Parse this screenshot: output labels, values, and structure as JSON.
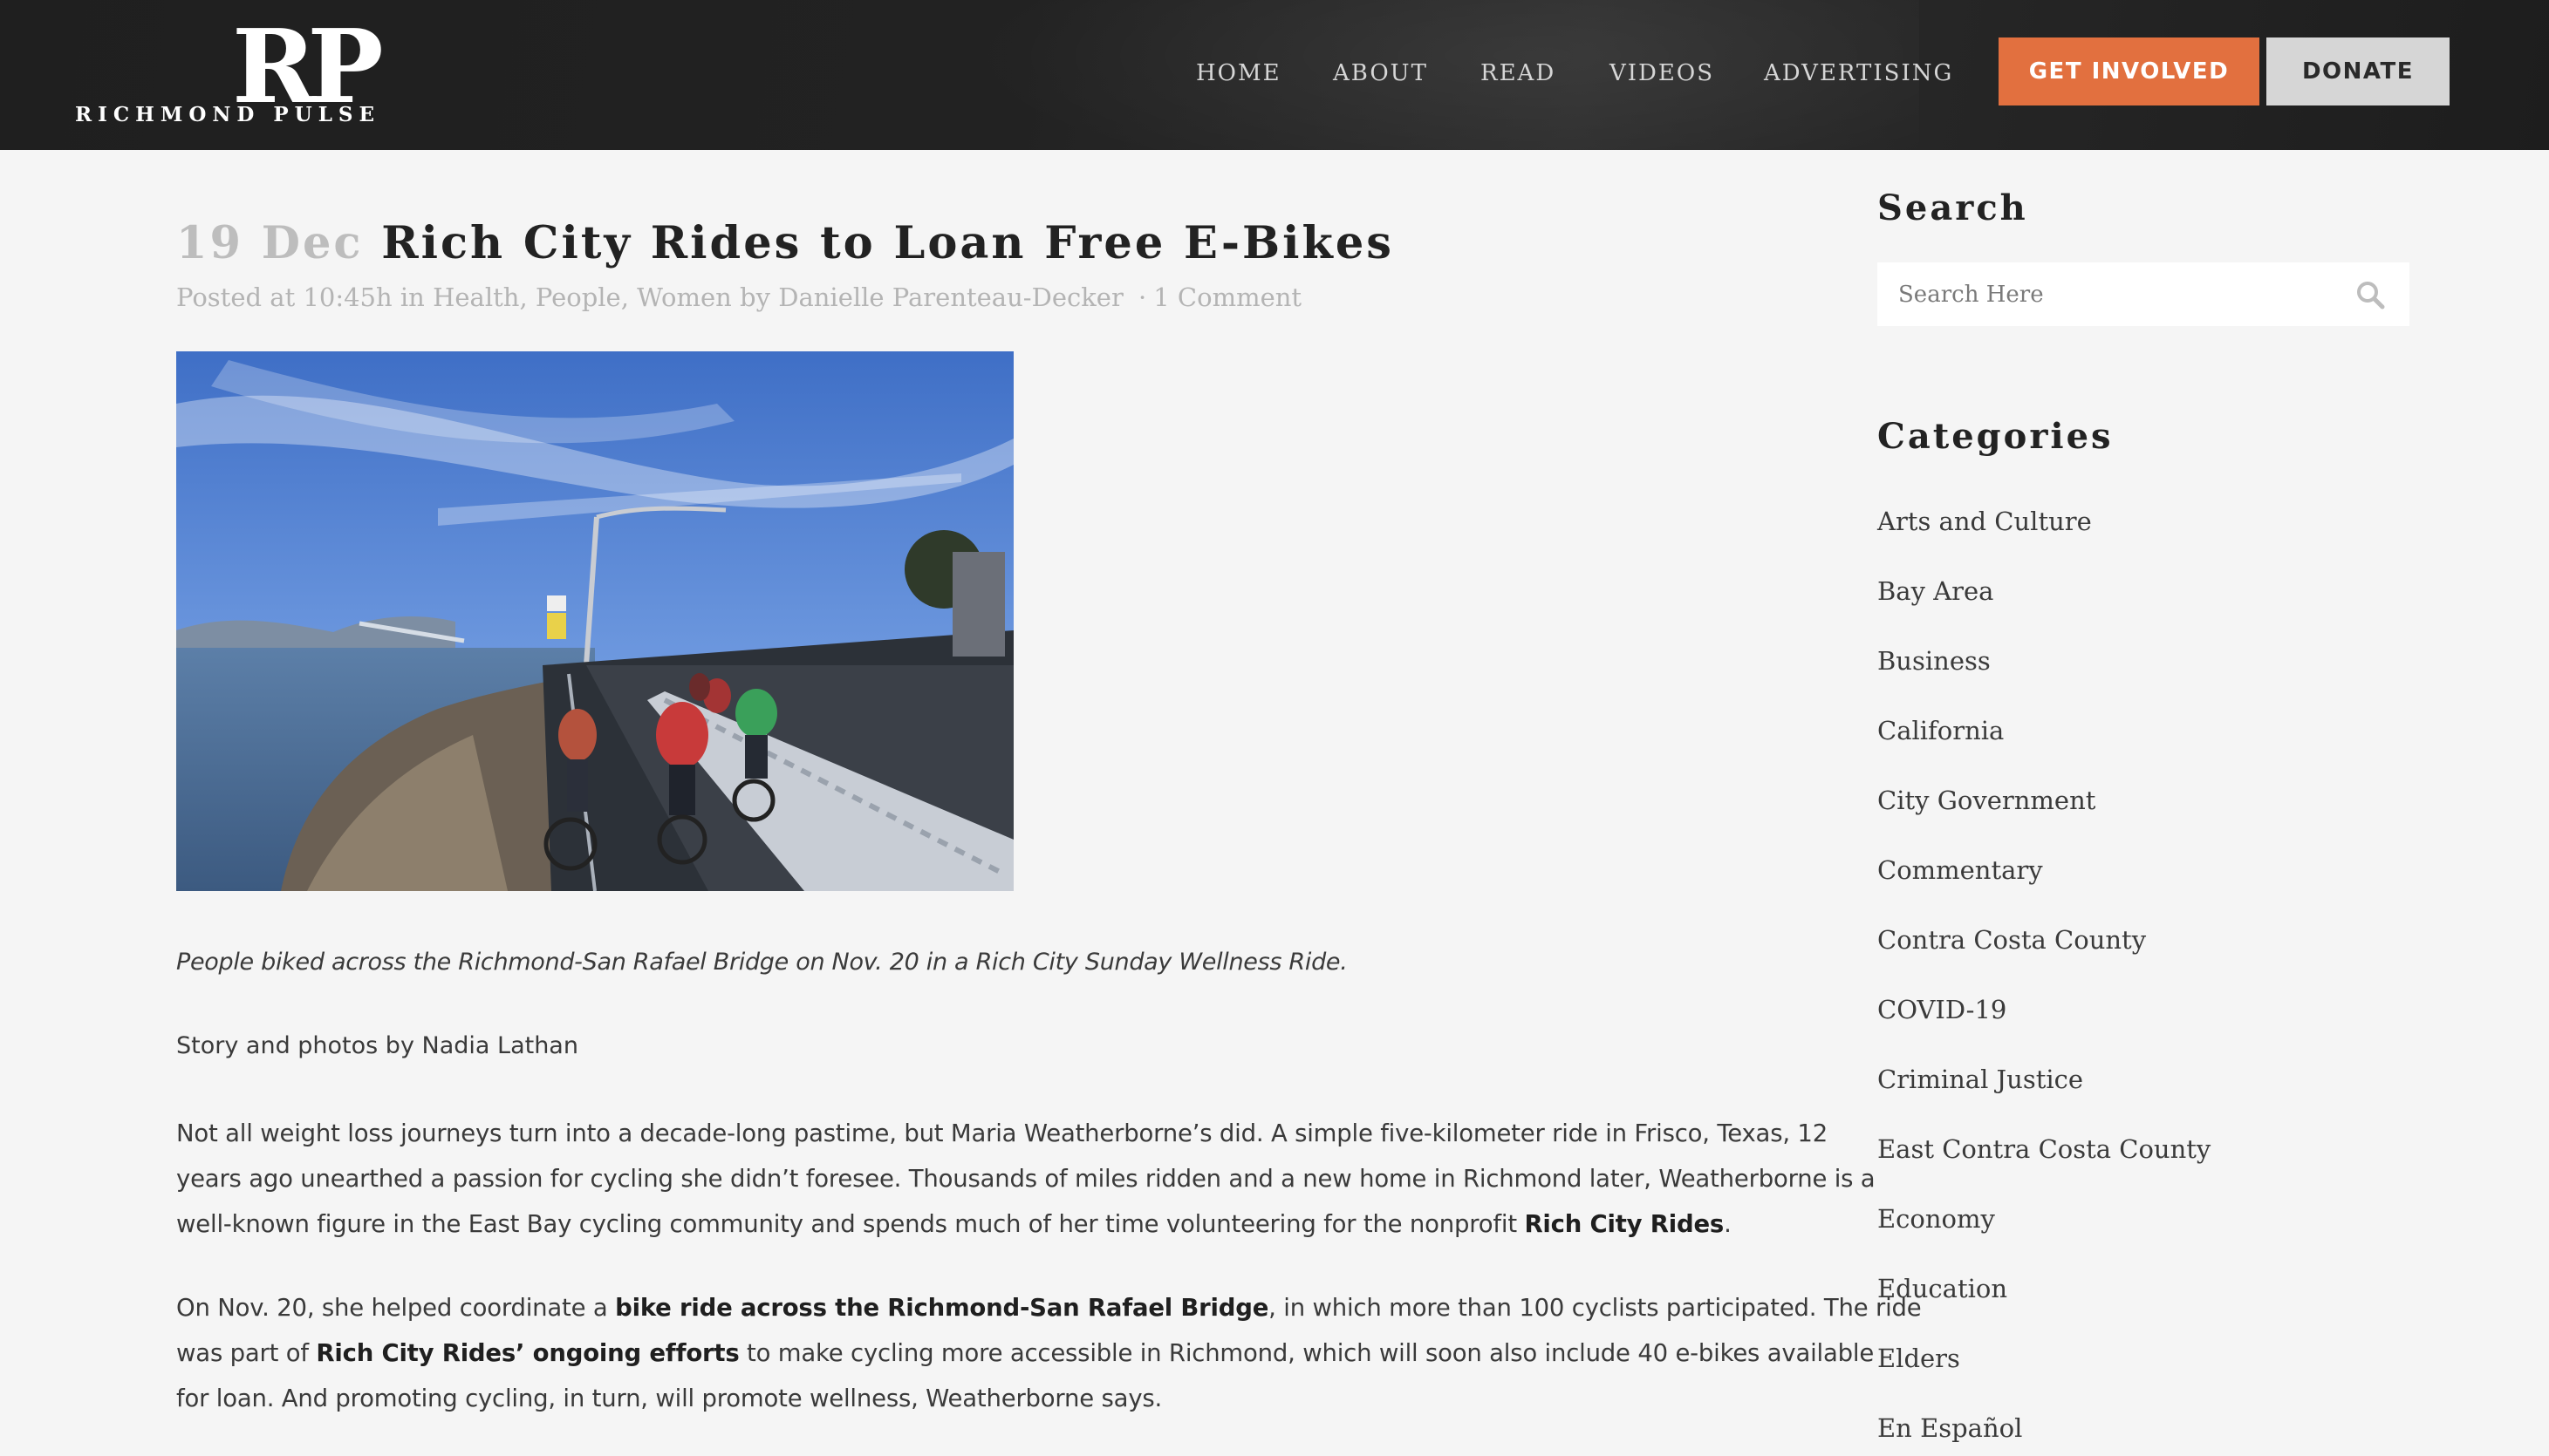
{
  "header": {
    "logo": {
      "mark": "RP",
      "name": "RICHMOND PULSE"
    },
    "nav": [
      "HOME",
      "ABOUT",
      "READ",
      "VIDEOS",
      "ADVERTISING"
    ],
    "cta": {
      "get_involved": "GET INVOLVED",
      "donate": "DONATE"
    },
    "colors": {
      "accent": "#e2703f",
      "header_bg": "#222222"
    }
  },
  "article": {
    "date": "19 Dec",
    "title": "Rich City Rides to Loan Free E-Bikes",
    "meta": {
      "posted_at": "Posted at 10:45h in",
      "categories": [
        "Health",
        "People",
        "Women"
      ],
      "by": "by",
      "author": "Danielle Parenteau-Decker",
      "comments": "1 Comment"
    },
    "image_alt": "People biking across the Richmond-San Rafael Bridge",
    "caption": "People biked across the Richmond-San Rafael Bridge on Nov. 20 in a Rich City Sunday Wellness Ride.",
    "byline": "Story and photos by Nadia Lathan",
    "p1": {
      "l1": "Not all weight loss journeys turn into a decade-long pastime, but Maria Weatherborne’s did. A simple five-kilometer ride in Frisco, Texas, 12",
      "l2": "years ago unearthed a passion for cycling she didn’t foresee. Thousands of miles ridden and a new home in Richmond later, Weatherborne is a",
      "l3a": "well-known figure in the East Bay cycling community and spends much of her time volunteering for the nonprofit ",
      "l3b": "Rich City Rides",
      "l3c": "."
    },
    "p2": {
      "l1a": "On Nov. 20, she helped coordinate a ",
      "l1b": "bike ride across the Richmond-San Rafael Bridge",
      "l1c": ", in which more than 100 cyclists participated. The ride",
      "l2a": "was part of ",
      "l2b": "Rich City Rides’ ongoing efforts",
      "l2c": " to make cycling more accessible in Richmond, which will soon also include 40 e-bikes available",
      "l3": "for loan. And promoting cycling, in turn, will promote wellness, Weatherborne says."
    }
  },
  "sidebar": {
    "search": {
      "heading": "Search",
      "placeholder": "Search Here"
    },
    "categories": {
      "heading": "Categories",
      "items": [
        "Arts and Culture",
        "Bay Area",
        "Business",
        "California",
        "City Government",
        "Commentary",
        "Contra Costa County",
        "COVID-19",
        "Criminal Justice",
        "East Contra Costa County",
        "Economy",
        "Education",
        "Elders",
        "En Español"
      ]
    }
  }
}
